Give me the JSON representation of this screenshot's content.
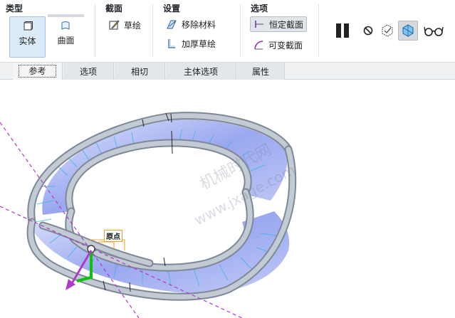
{
  "ribbon": {
    "type_group": {
      "title": "类型",
      "solid_label": "实体",
      "surface_label": "曲面",
      "selected": "实体"
    },
    "section_group": {
      "title": "截面",
      "sketch_label": "草绘"
    },
    "settings_group": {
      "title": "设置",
      "remove_material_label": "移除材料",
      "thicken_sketch_label": "加厚草绘"
    },
    "options_group": {
      "title": "选项",
      "constant_section_label": "恒定截面",
      "variable_section_label": "可变截面",
      "selected": "恒定截面"
    },
    "tools": [
      "pause-icon",
      "no-preview-icon",
      "verify-preview-icon",
      "feature-preview-icon",
      "glasses-icon"
    ]
  },
  "tabs": [
    {
      "label": "参考",
      "selected": true
    },
    {
      "label": "选项",
      "selected": false
    },
    {
      "label": "相切",
      "selected": false
    },
    {
      "label": "主体选项",
      "selected": false
    },
    {
      "label": "属性",
      "selected": false
    }
  ],
  "viewport": {
    "start_point_label": "原点",
    "watermark_line1": "机械时代网",
    "watermark_line2": "www.jxage.com"
  },
  "colors": {
    "accent": "#dcebfa",
    "surface_fill": "#a9b4f0",
    "tube": "#aeb8c4",
    "trajectory": "#b03bc8",
    "arrow_green": "#10c010"
  }
}
